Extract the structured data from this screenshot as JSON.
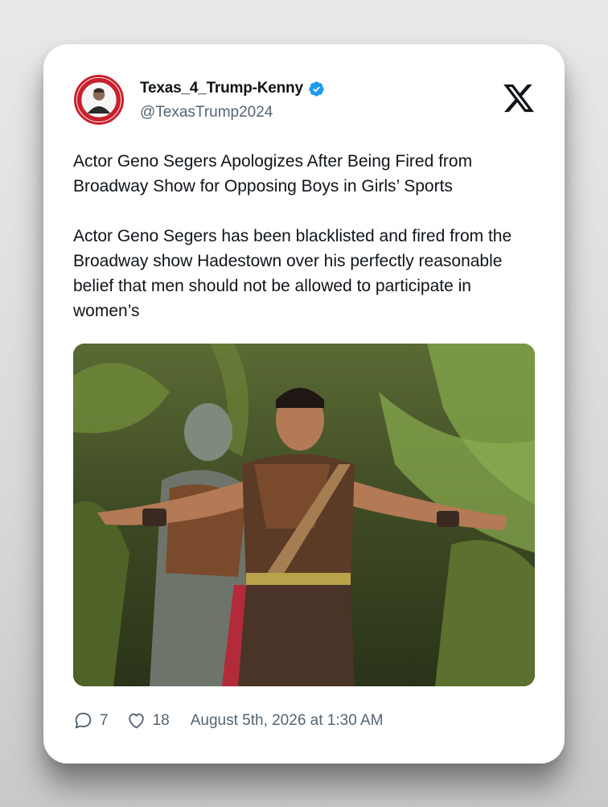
{
  "tweet": {
    "display_name": "Texas_4_Trump-Kenny",
    "handle": "@TexasTrump2024",
    "verified": true,
    "avatar_icon": "profile-photo-avatar",
    "platform_logo": "x-logo-icon",
    "headline": "Actor Geno Segers Apologizes After Being Fired from Broadway Show for Opposing Boys in Girls’ Sports",
    "body": "Actor Geno Segers has been blacklisted and fired from the Broadway show Hadestown over his perfectly reasonable belief that men should not be allowed to participate in women’s",
    "media": {
      "icon": "photo-image",
      "description_colors": [
        "#3e4a24",
        "#6f8a3a",
        "#7a4a2c"
      ]
    },
    "stats": {
      "replies": "7",
      "likes": "18"
    },
    "timestamp": "August 5th, 2026 at 1:30 AM"
  },
  "colors": {
    "verified_blue": "#1d9bf0",
    "text_primary": "#0f1419",
    "text_secondary": "#536471",
    "avatar_ring": "#c8202c"
  }
}
